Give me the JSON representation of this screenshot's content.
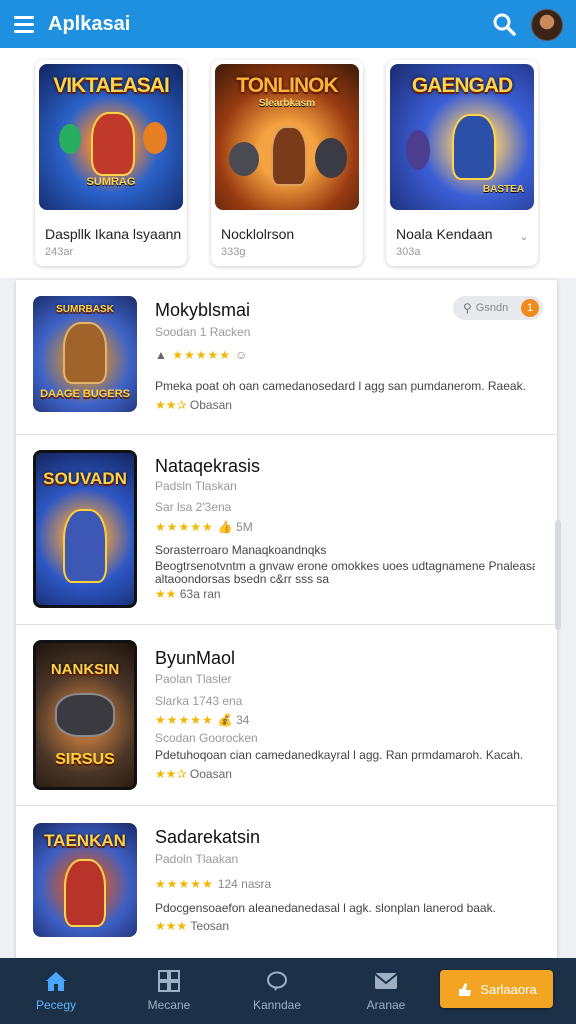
{
  "header": {
    "title": "Aplkasai",
    "menu_icon": "hamburger-menu-icon",
    "search_icon": "search-icon"
  },
  "featured": [
    {
      "art_title": "VIKTAEASAI",
      "name": "Daspllk  Ikana lsyaann",
      "size": "243ar",
      "art_sub": "SUMRAG"
    },
    {
      "art_title": "TONLINOK",
      "name": "Nocklolrson",
      "size": "333g",
      "art_sub": "Slearbkasm"
    },
    {
      "art_title": "GAENGAD",
      "name": "Noala Kendaan",
      "size": "303a",
      "art_sub": "BASTEA"
    }
  ],
  "list": [
    {
      "name": "Mokyblsmai",
      "publisher": "Soodan 1 Racken",
      "rating_line": "★★★★★",
      "rating_extra": "☺",
      "desc": "Pmeka poat oh oan camedanosedard l agg san pumdanerom. Raeak.",
      "mini": "Obasan",
      "art_title": "SUMRBASK",
      "art_sub": "DAAGE BUGERS",
      "pill": {
        "label": "Gsndn",
        "count": "1"
      }
    },
    {
      "name": "Nataqekrasis",
      "publisher": "Padsln Tlaskan",
      "stats": "Sar lsa  2'3ena",
      "rating_line": "★★★★★",
      "rating_extra": "👍 5M",
      "desc": "Sorasterroaro Manaqkoandnqks",
      "desc2": "Beogtrsenotvntm a gnvaw erone omokkes uoes udtagnamene Pnaleasan",
      "desc3": "altaoondorsas bsedn c&rr sss sa",
      "mini": "63a ran",
      "art_title": "SOUVADN",
      "art_sub": ""
    },
    {
      "name": "ByunMaol",
      "publisher": "Paolan Tlasler",
      "stats": "Slarka 1743 ena",
      "rating_line": "★★★★★",
      "rating_extra": "💰 34",
      "desc": "Scodan Goorocken",
      "desc2": "Pdetuhoqoan cian camedanedkayral l agg. Ran prmdamaroh. Kacah.",
      "mini": "Ooasan",
      "art_title": "NANKSIN",
      "art_sub": "SIRSUS"
    },
    {
      "name": "Sadarekatsin",
      "publisher": "Padoln Tlaakan",
      "rating_line": "★★★★★",
      "rating_extra": "124 nasra",
      "desc": "Pdocgensoaefon aleanedanedasal l agk. slonplan lanerod baak.",
      "mini": "Teosan",
      "art_title": "TAENKAN",
      "art_sub": ""
    }
  ],
  "bottom_nav": [
    {
      "label": "Pecegy",
      "icon": "home-icon",
      "active": true
    },
    {
      "label": "Mecane",
      "icon": "grid-icon",
      "active": false
    },
    {
      "label": "Kanndae",
      "icon": "chat-icon",
      "active": false
    },
    {
      "label": "Aranae",
      "icon": "mail-icon",
      "active": false
    }
  ],
  "cta": {
    "label": "Sarlaaora",
    "icon": "hand-icon"
  },
  "colors": {
    "topbar": "#1f8fe0",
    "bottom_nav": "#1c3048",
    "accent": "#f3a423",
    "star": "#f2b705"
  }
}
